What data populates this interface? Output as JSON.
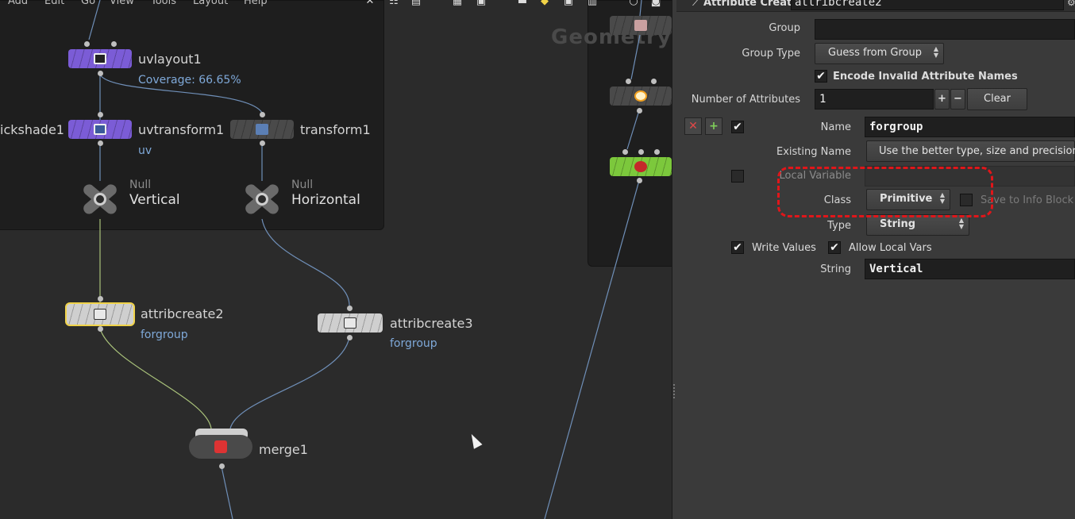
{
  "menu": {
    "items": [
      "Add",
      "Edit",
      "Go",
      "View",
      "Tools",
      "Layout",
      "Help"
    ]
  },
  "network": {
    "context_label": "Geometry",
    "nodes": {
      "uvlayout": {
        "name": "uvlayout1",
        "info": "Coverage: 66.65%"
      },
      "quickshade": {
        "name": "ickshade1"
      },
      "uvtransform": {
        "name": "uvtransform1",
        "info": "uv"
      },
      "transform": {
        "name": "transform1"
      },
      "null_vertical": {
        "type": "Null",
        "name": "Vertical"
      },
      "null_horizontal": {
        "type": "Null",
        "name": "Horizontal"
      },
      "attribcreate2": {
        "name": "attribcreate2",
        "info": "forgroup"
      },
      "attribcreate3": {
        "name": "attribcreate3",
        "info": "forgroup"
      },
      "merge": {
        "name": "merge1"
      }
    }
  },
  "params": {
    "node_type": "Attribute Create",
    "node_name": "attribcreate2",
    "group": {
      "label": "Group",
      "value": ""
    },
    "group_type": {
      "label": "Group Type",
      "value": "Guess from Group"
    },
    "encode_invalid": {
      "label": "Encode Invalid Attribute Names",
      "checked": true
    },
    "num_attributes": {
      "label": "Number of Attributes",
      "value": "1",
      "plus": "+",
      "minus": "−",
      "clear": "Clear"
    },
    "name": {
      "label": "Name",
      "value": "forgroup"
    },
    "existing_name": {
      "label": "Existing Name",
      "value": "Use the better type, size and precision"
    },
    "local_variable": {
      "label": "Local Variable",
      "value": ""
    },
    "class": {
      "label": "Class",
      "value": "Primitive"
    },
    "save_info": {
      "label": "Save to Info Block"
    },
    "type": {
      "label": "Type",
      "value": "String"
    },
    "write_values": {
      "label": "Write Values"
    },
    "allow_local_vars": {
      "label": "Allow Local Vars"
    },
    "string": {
      "label": "String",
      "value": "Vertical"
    },
    "remove_icon": "✕",
    "add_icon": "+",
    "check_glyph": "✔"
  },
  "colors": {
    "accent": "#7fa9d9",
    "highlight": "#e0161a",
    "selected": "#f0d34a"
  }
}
